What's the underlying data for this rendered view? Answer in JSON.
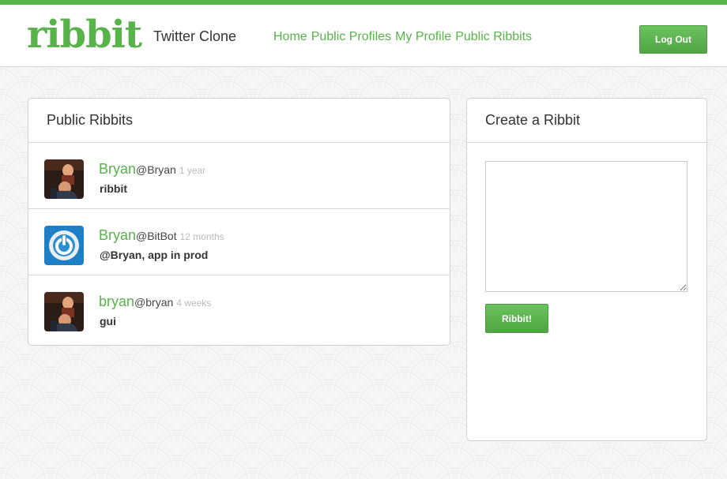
{
  "header": {
    "logo": "ribbit",
    "tagline": "Twitter Clone",
    "nav": [
      "Home",
      "Public Profiles",
      "My Profile",
      "Public Ribbits"
    ],
    "logout_label": "Log Out",
    "accent_color": "#57b34a"
  },
  "feed": {
    "title": "Public Ribbits",
    "items": [
      {
        "name": "Bryan",
        "handle": "@Bryan",
        "time": "1 year",
        "text": "ribbit",
        "avatar": "photo-avatar"
      },
      {
        "name": "Bryan",
        "handle": "@BitBot",
        "time": "12 months",
        "text": "@Bryan, app in prod",
        "avatar": "power-icon-avatar"
      },
      {
        "name": "bryan",
        "handle": "@bryan",
        "time": "4 weeks",
        "text": "gui",
        "avatar": "photo-avatar"
      }
    ]
  },
  "create": {
    "title": "Create a Ribbit",
    "textarea_value": "",
    "submit_label": "Ribbit!"
  }
}
